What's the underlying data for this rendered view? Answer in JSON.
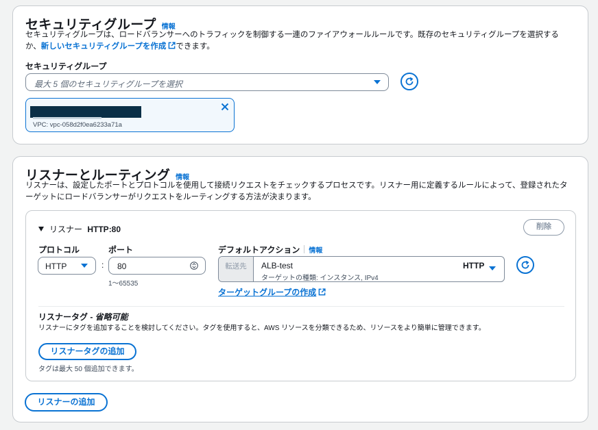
{
  "security_group": {
    "title": "セキュリティグループ",
    "info": "情報",
    "desc_before_link": "セキュリティグループは、ロードバランサーへのトラフィックを制御する一連のファイアウォールルールです。既存のセキュリティグループを選択するか、",
    "create_link": "新しいセキュリティグループを作成",
    "desc_after_link": "できます。",
    "field_label": "セキュリティグループ",
    "select_placeholder": "最大 5 個のセキュリティグループを選択",
    "selected_item": {
      "vpc": "VPC: vpc-058d2f0ea6233a71a"
    }
  },
  "listeners": {
    "title": "リスナーとルーティング",
    "info": "情報",
    "desc": "リスナーは、設定したポートとプロトコルを使用して接続リクエストをチェックするプロセスです。リスナー用に定義するルールによって、登録されたターゲットにロードバランサーがリクエストをルーティングする方法が決まります。",
    "listener": {
      "prefix": "リスナー",
      "name": "HTTP:80",
      "delete_label": "削除",
      "protocol_label": "プロトコル",
      "protocol_value": "HTTP",
      "port_label": "ポート",
      "port_value": "80",
      "port_range": "1〜65535",
      "default_action_label": "デフォルトアクション",
      "info": "情報",
      "forward_label": "転送先",
      "target_name": "ALB-test",
      "target_desc": "ターゲットの種類: インスタンス, IPv4",
      "target_protocol": "HTTP",
      "create_target_group_link": "ターゲットグループの作成",
      "tags_title": "リスナータグ - ",
      "tags_optional": "省略可能",
      "tags_desc": "リスナーにタグを追加することを検討してください。タグを使用すると、AWS リソースを分類できるため、リソースをより簡単に管理できます。",
      "add_tag_button": "リスナータグの追加",
      "tag_limit": "タグは最大 50 個追加できます。"
    },
    "add_listener_button": "リスナーの追加"
  }
}
